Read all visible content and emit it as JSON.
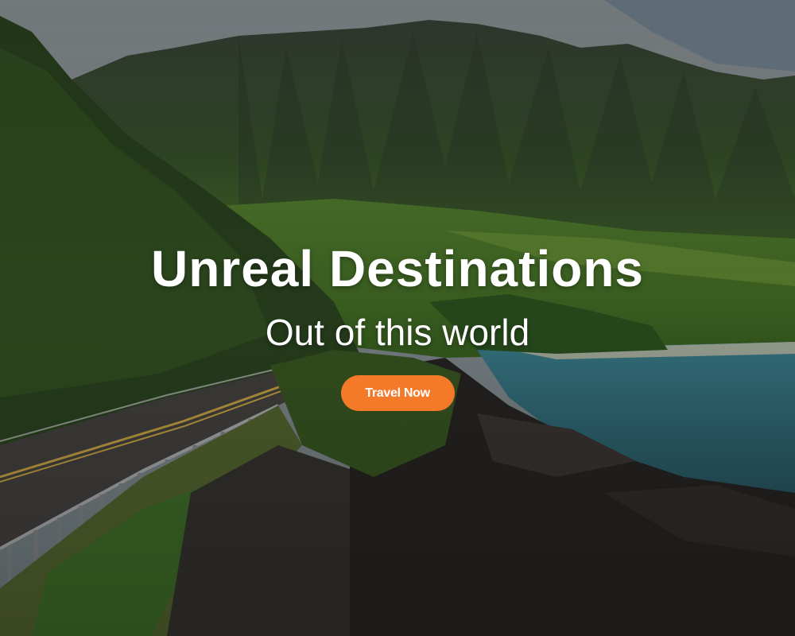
{
  "hero": {
    "title": "Unreal Destinations",
    "subtitle": "Out of this world",
    "cta_label": "Travel Now",
    "background_image": "coastal-mountain-road-photo"
  },
  "colors": {
    "cta_background": "#f47a2a",
    "text": "#ffffff"
  }
}
